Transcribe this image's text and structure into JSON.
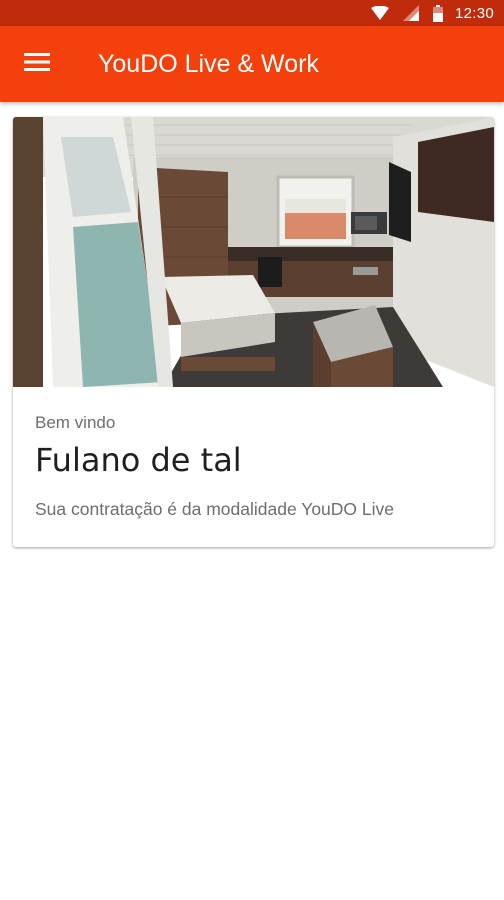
{
  "status_bar": {
    "time": "12:30",
    "icons": [
      "wifi-icon",
      "cell-signal-icon",
      "battery-icon"
    ]
  },
  "app_bar": {
    "menu_icon": "hamburger-menu-icon",
    "title": "YouDO Live & Work"
  },
  "colors": {
    "primary": "#f4410c",
    "primary_dark": "#c02b0b",
    "text_primary": "#1f1f1f",
    "text_secondary": "#6e6e6e"
  },
  "card": {
    "image": "room-photo",
    "greeting": "Bem vindo",
    "user_name": "Fulano de tal",
    "plan_text": "Sua contratação é da modalidade YouDO Live"
  }
}
